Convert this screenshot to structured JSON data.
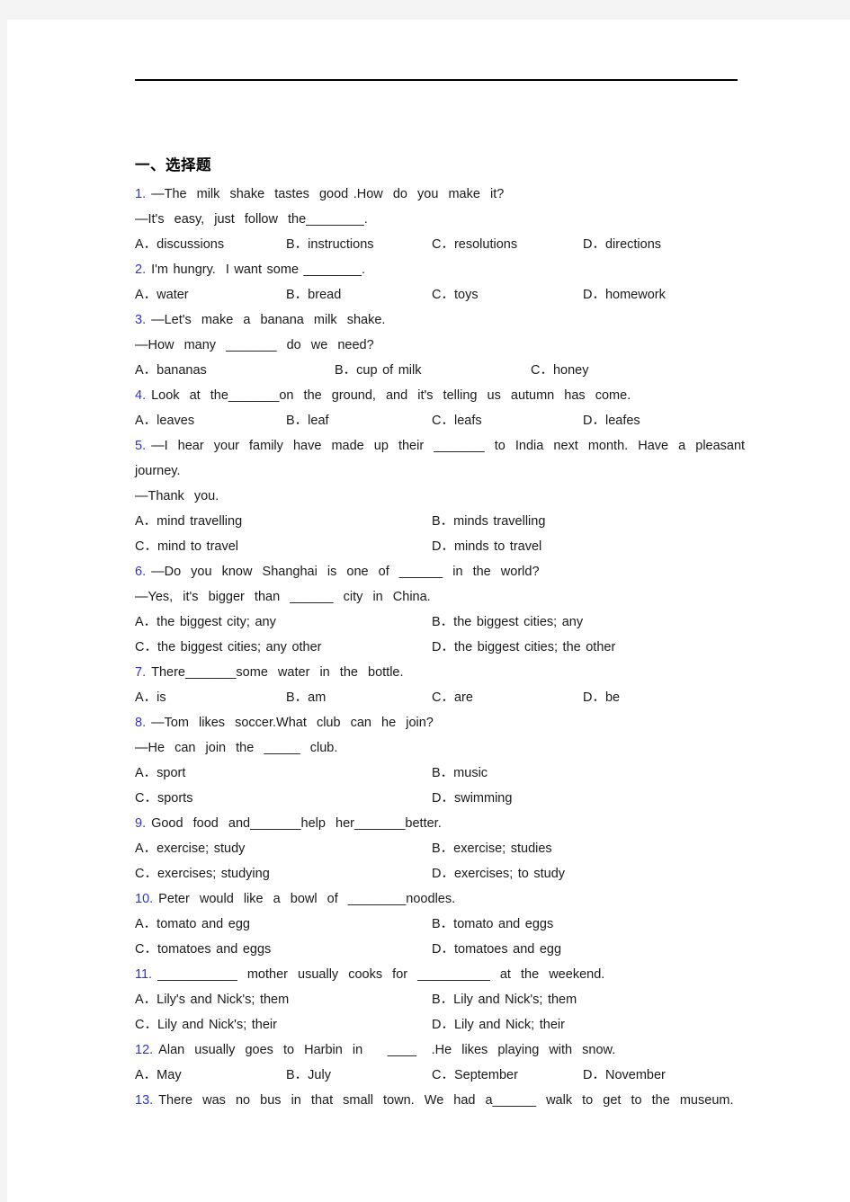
{
  "document": {
    "section_heading": "一、选择题",
    "questions": [
      {
        "num": "1.",
        "lines": [
          "—The  milk  shake  tastes  good .How  do  you  make  it?",
          "—It's  easy,  just  follow  the________."
        ],
        "layout": "four",
        "options": [
          "A．discussions",
          "B．instructions",
          "C．resolutions",
          "D．directions"
        ]
      },
      {
        "num": "2.",
        "lines": [
          "I'm hungry.  I want some ________."
        ],
        "layout": "four",
        "options": [
          "A．water",
          "B．bread",
          "C．toys",
          "D．homework"
        ]
      },
      {
        "num": "3.",
        "lines": [
          "—Let's  make  a  banana  milk  shake.",
          "—How  many  _______  do  we  need?"
        ],
        "layout": "three",
        "options": [
          "A．bananas",
          "B．cup of milk",
          "C．honey"
        ]
      },
      {
        "num": "4.",
        "lines": [
          "Look  at  the_______on  the  ground,  and  it's  telling  us  autumn  has  come."
        ],
        "layout": "four",
        "options": [
          "A．leaves",
          "B．leaf",
          "C．leafs",
          "D．leafes"
        ]
      },
      {
        "num": "5.",
        "lines": [
          "—I  hear  your  family  have  made  up  their  _______  to  India  next  month.  Have  a  pleasant",
          "journey.",
          "—Thank  you."
        ],
        "layout": "two",
        "options": [
          "A．mind travelling",
          "B．minds travelling",
          "C．mind to travel",
          "D．minds to travel"
        ]
      },
      {
        "num": "6.",
        "lines": [
          "—Do  you  know  Shanghai  is  one  of  ______  in  the  world?",
          "—Yes,  it's  bigger  than  ______  city  in  China."
        ],
        "layout": "two",
        "options": [
          "A．the biggest city; any",
          "B．the biggest cities; any",
          "C．the biggest cities; any other",
          "D．the biggest cities; the other"
        ]
      },
      {
        "num": "7.",
        "lines": [
          "There_______some  water  in  the  bottle."
        ],
        "layout": "four",
        "options": [
          "A．is",
          "B．am",
          "C．are",
          "D．be"
        ]
      },
      {
        "num": "8.",
        "lines": [
          "—Tom  likes  soccer.What  club  can  he  join?",
          "—He  can  join  the  _____  club."
        ],
        "layout": "two",
        "options": [
          "A．sport",
          "B．music",
          "C．sports",
          "D．swimming"
        ]
      },
      {
        "num": "9.",
        "lines": [
          "Good  food  and_______help  her_______better."
        ],
        "layout": "two",
        "options": [
          "A．exercise; study",
          "B．exercise; studies",
          "C．exercises; studying",
          "D．exercises; to study"
        ]
      },
      {
        "num": "10.",
        "lines": [
          "Peter  would  like  a  bowl  of  ________noodles."
        ],
        "layout": "two",
        "options": [
          "A．tomato and egg",
          "B．tomato and eggs",
          "C．tomatoes and eggs",
          "D．tomatoes and egg"
        ]
      },
      {
        "num": "11.",
        "lines": [
          "___________  mother  usually  cooks  for  __________  at  the  weekend."
        ],
        "layout": "two",
        "options": [
          "A．Lily's and Nick's; them",
          "B．Lily and Nick's; them",
          "C．Lily and Nick's; their",
          "D．Lily and Nick; their"
        ]
      },
      {
        "num": "12.",
        "lines": [
          "Alan  usually  goes  to  Harbin  in     ____   .He  likes  playing  with  snow."
        ],
        "layout": "four",
        "options": [
          "A．May",
          "B．July",
          "C．September",
          "D．November"
        ]
      },
      {
        "num": "13.",
        "lines": [
          "There  was  no  bus  in  that  small  town.  We  had  a______  walk  to  get  to  the  museum."
        ],
        "layout": "none",
        "options": []
      }
    ],
    "colors": {
      "question_number": "#3333cc",
      "text": "#1a1a1a",
      "page_background": "#ffffff",
      "canvas_background": "#f4f4f4"
    }
  }
}
